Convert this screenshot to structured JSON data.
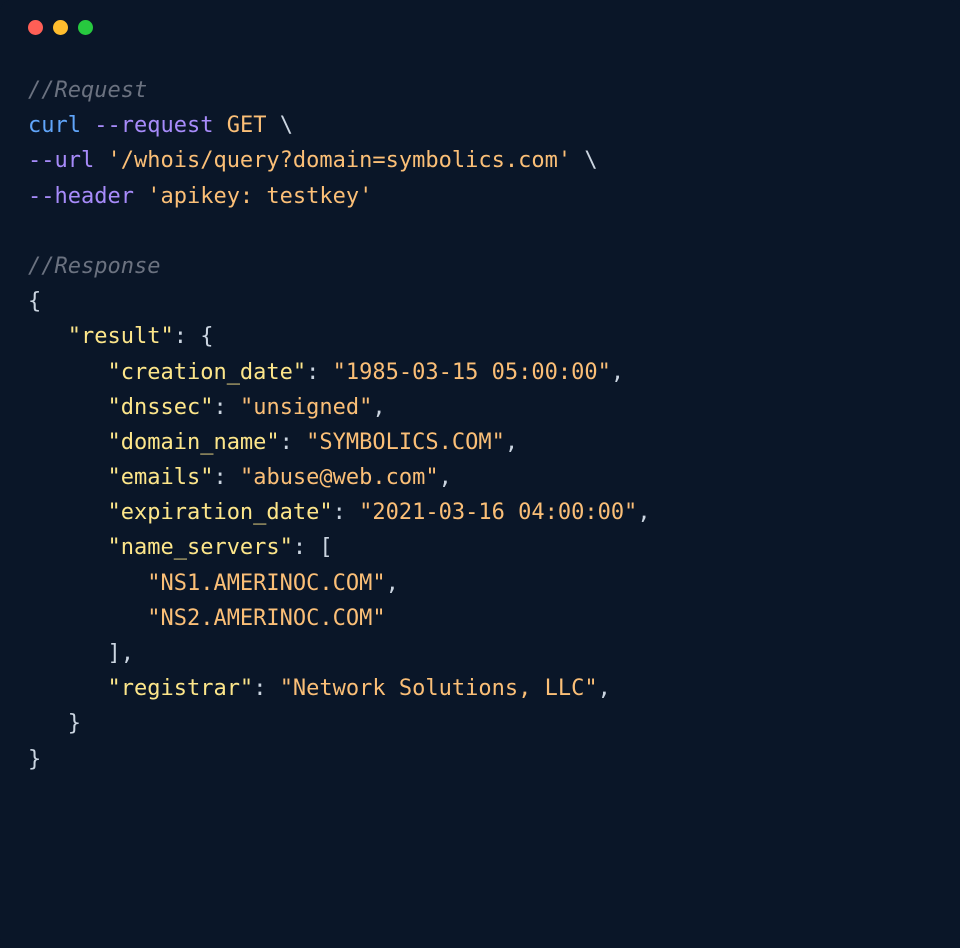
{
  "request": {
    "commentLabel": "//Request",
    "cmd": "curl",
    "requestFlag": "--request",
    "method": "GET",
    "urlFlag": "--url",
    "url": "'/whois/query?domain=symbolics.com'",
    "headerFlag": "--header",
    "header": "'apikey: testkey'",
    "backslash": " \\"
  },
  "response": {
    "commentLabel": "//Response",
    "openBrace": "{",
    "closeBrace": "}",
    "resultKey": "\"result\"",
    "colon": ": ",
    "openBrace2": "{",
    "closeBrace2": "}",
    "comma": ",",
    "creationDateKey": "\"creation_date\"",
    "creationDateVal": "\"1985-03-15 05:00:00\"",
    "dnssecKey": "\"dnssec\"",
    "dnssecVal": "\"unsigned\"",
    "domainNameKey": "\"domain_name\"",
    "domainNameVal": "\"SYMBOLICS.COM\"",
    "emailsKey": "\"emails\"",
    "emailsVal": "\"abuse@web.com\"",
    "expirationDateKey": "\"expiration_date\"",
    "expirationDateVal": "\"2021-03-16 04:00:00\"",
    "nameServersKey": "\"name_servers\"",
    "openBracket": "[",
    "closeBracket": "]",
    "ns1": "\"NS1.AMERINOC.COM\"",
    "ns2": "\"NS2.AMERINOC.COM\"",
    "registrarKey": "\"registrar\"",
    "registrarVal": "\"Network Solutions, LLC\""
  }
}
